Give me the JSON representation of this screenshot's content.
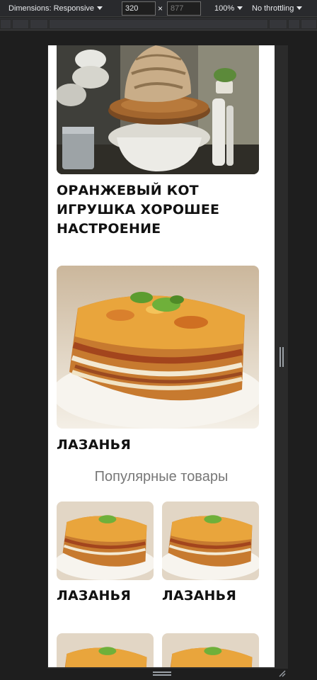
{
  "toolbar": {
    "dimensions_label": "Dimensions: Responsive",
    "width_value": "320",
    "times": "×",
    "height_placeholder": "877",
    "zoom_label": "100%",
    "throttle_label": "No throttling"
  },
  "page": {
    "product_top": {
      "title_line1": "ОРАНЖЕВЫЙ КОТ",
      "title_line2": "ИГРУШКА ХОРОШЕЕ",
      "title_line3": "НАСТРОЕНИЕ"
    },
    "product_lasagna": {
      "title": "ЛАЗАНЬЯ"
    },
    "popular_heading": "Популярные товары",
    "popular_items": [
      {
        "title": "ЛАЗАНЬЯ"
      },
      {
        "title": "ЛАЗАНЬЯ"
      }
    ]
  }
}
